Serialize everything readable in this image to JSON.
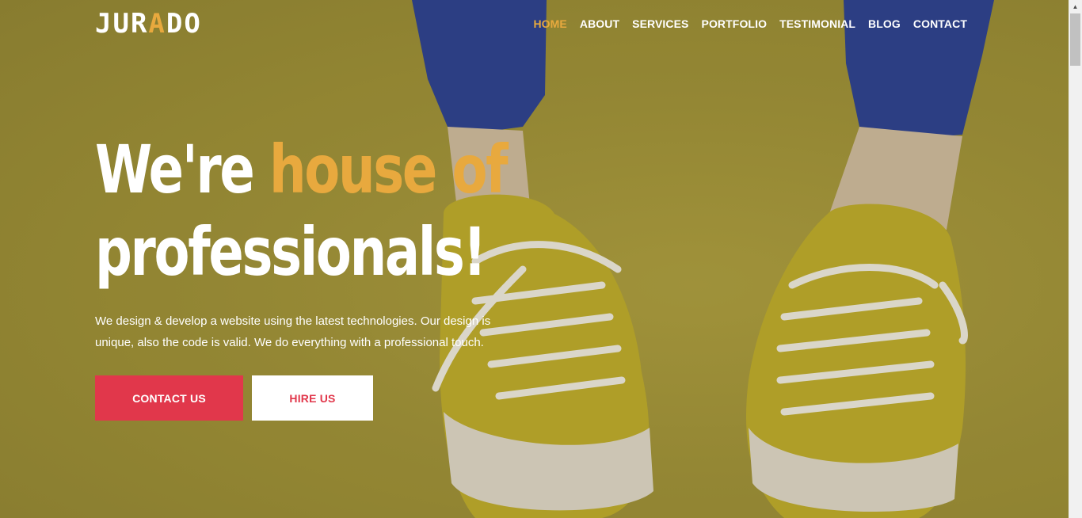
{
  "logo": {
    "part1": "JUR",
    "accent": "A",
    "part2": "DO"
  },
  "nav": {
    "items": [
      {
        "label": "HOME",
        "active": true
      },
      {
        "label": "ABOUT"
      },
      {
        "label": "SERVICES"
      },
      {
        "label": "PORTFOLIO"
      },
      {
        "label": "TESTIMONIAL"
      },
      {
        "label": "BLOG"
      },
      {
        "label": "CONTACT"
      }
    ]
  },
  "hero": {
    "headline_part1": "We're ",
    "headline_accent": "house of",
    "headline_line2": "professionals!",
    "lead": "We design & develop a website using the latest technologies. Our design is unique, also the code is valid. We do everything with a professional touch.",
    "contact_button": "CONTACT US",
    "hire_button": "HIRE US"
  },
  "colors": {
    "accent": "#e8a93e",
    "brand_red": "#e1374b",
    "background": "#9c8f38"
  }
}
